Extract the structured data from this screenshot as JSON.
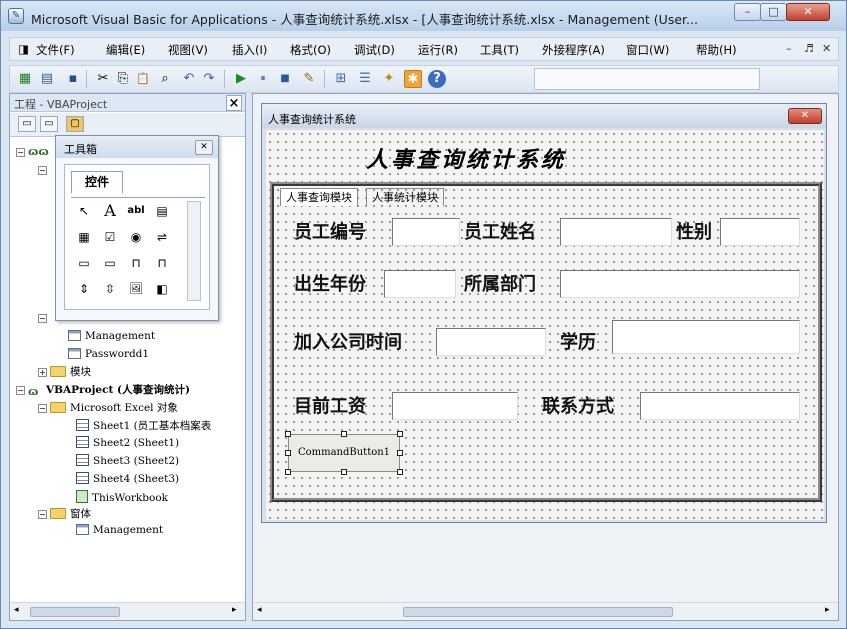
{
  "window": {
    "title": "Microsoft Visual Basic for Applications - 人事查询统计系统.xlsx - [人事查询统计系统.xlsx - Management (User...",
    "app_icon": "vba-icon",
    "min_glyph": "–",
    "max_glyph": "□",
    "close_glyph": "✕"
  },
  "menubar": {
    "doc_icon_glyph": "◨",
    "items": [
      "文件(F)",
      "编辑(E)",
      "视图(V)",
      "插入(I)",
      "格式(O)",
      "调试(D)",
      "运行(R)",
      "工具(T)",
      "外接程序(A)",
      "窗口(W)",
      "帮助(H)"
    ],
    "mdi_min": "–",
    "mdi_restore": "♬",
    "mdi_close": "✕"
  },
  "toolbar": {
    "icons": [
      "excel-icon",
      "insert-userform-icon",
      "save-icon",
      "cut-icon",
      "copy-icon",
      "paste-icon",
      "find-icon",
      "undo-icon",
      "redo-icon",
      "run-icon",
      "break-icon",
      "reset-icon",
      "design-mode-icon",
      "project-explorer-icon",
      "properties-icon",
      "object-browser-icon",
      "toolbox-icon",
      "help-icon"
    ],
    "glyphs": [
      "▦",
      "▤",
      "▪",
      "✂",
      "⎘",
      "📋",
      "⌕",
      "↶",
      "↷",
      "▶",
      "⏸",
      "■",
      "✎",
      "⊞",
      "☰",
      "✦",
      "✱",
      "?"
    ]
  },
  "project_pane": {
    "title": "工程 - VBAProject",
    "close_glyph": "×",
    "tool_glyphs": [
      "▭",
      "▭",
      "▢"
    ]
  },
  "tree": {
    "items": [
      {
        "label": "ɷɷ",
        "icon": "project-icon",
        "indent": 0,
        "exp": "−"
      },
      {
        "label": "",
        "icon": "folder-icon",
        "indent": 1,
        "exp": "−"
      },
      {
        "label": "Management",
        "icon": "form-icon",
        "indent": 2
      },
      {
        "label": "Passwordd1",
        "icon": "form-icon",
        "indent": 2
      },
      {
        "label": "模块",
        "icon": "folder-icon",
        "indent": 1,
        "exp": "+"
      },
      {
        "label": "VBAProject (人事查询统计)",
        "icon": "project-icon",
        "indent": 0,
        "exp": "−"
      },
      {
        "label": "Microsoft Excel 对象",
        "icon": "folder-icon",
        "indent": 1,
        "exp": "−"
      },
      {
        "label": "Sheet1 (员工基本档案表",
        "icon": "sheet-icon",
        "indent": 2
      },
      {
        "label": "Sheet2 (Sheet1)",
        "icon": "sheet-icon",
        "indent": 2
      },
      {
        "label": "Sheet3 (Sheet2)",
        "icon": "sheet-icon",
        "indent": 2
      },
      {
        "label": "Sheet4 (Sheet3)",
        "icon": "sheet-icon",
        "indent": 2
      },
      {
        "label": "ThisWorkbook",
        "icon": "workbook-icon",
        "indent": 2
      },
      {
        "label": "窗体",
        "icon": "folder-icon",
        "indent": 1,
        "exp": "−"
      },
      {
        "label": "Management",
        "icon": "form-icon",
        "indent": 2
      }
    ]
  },
  "toolbox": {
    "title": "工具箱",
    "close_glyph": "✕",
    "tab": "控件",
    "tools": [
      {
        "name": "select-objects-icon",
        "glyph": "↖"
      },
      {
        "name": "label-tool-icon",
        "glyph": "A"
      },
      {
        "name": "textbox-tool-icon",
        "glyph": "abl"
      },
      {
        "name": "combobox-tool-icon",
        "glyph": "▤"
      },
      {
        "name": "listbox-tool-icon",
        "glyph": "▦"
      },
      {
        "name": "checkbox-tool-icon",
        "glyph": "☑"
      },
      {
        "name": "optionbutton-tool-icon",
        "glyph": "◉"
      },
      {
        "name": "togglebutton-tool-icon",
        "glyph": "⇌"
      },
      {
        "name": "frame-tool-icon",
        "glyph": "▭"
      },
      {
        "name": "commandbutton-tool-icon",
        "glyph": "▭"
      },
      {
        "name": "tabstrip-tool-icon",
        "glyph": "⊓"
      },
      {
        "name": "multipage-tool-icon",
        "glyph": "⊓"
      },
      {
        "name": "scrollbar-tool-icon",
        "glyph": "⇕"
      },
      {
        "name": "spinbutton-tool-icon",
        "glyph": "⇳"
      },
      {
        "name": "image-tool-icon",
        "glyph": "🖼"
      },
      {
        "name": "refedit-tool-icon",
        "glyph": "◧"
      }
    ]
  },
  "form": {
    "window_title": "人事查询统计系统",
    "close_glyph": "✕",
    "caption": "人事查询统计系统",
    "tabs": [
      "人事查询模块",
      "人事统计模块"
    ],
    "labels": {
      "emp_id": "员工编号",
      "emp_name": "员工姓名",
      "gender": "性别",
      "birth_year": "出生年份",
      "department": "所属部门",
      "join_date": "加入公司时间",
      "education": "学历",
      "salary": "目前工资",
      "contact": "联系方式"
    },
    "command_button": "CommandButton1"
  },
  "colors": {
    "title_bg": "#c9d8ea",
    "close_red": "#c2412a",
    "form_dots": "#7a7a7a"
  }
}
